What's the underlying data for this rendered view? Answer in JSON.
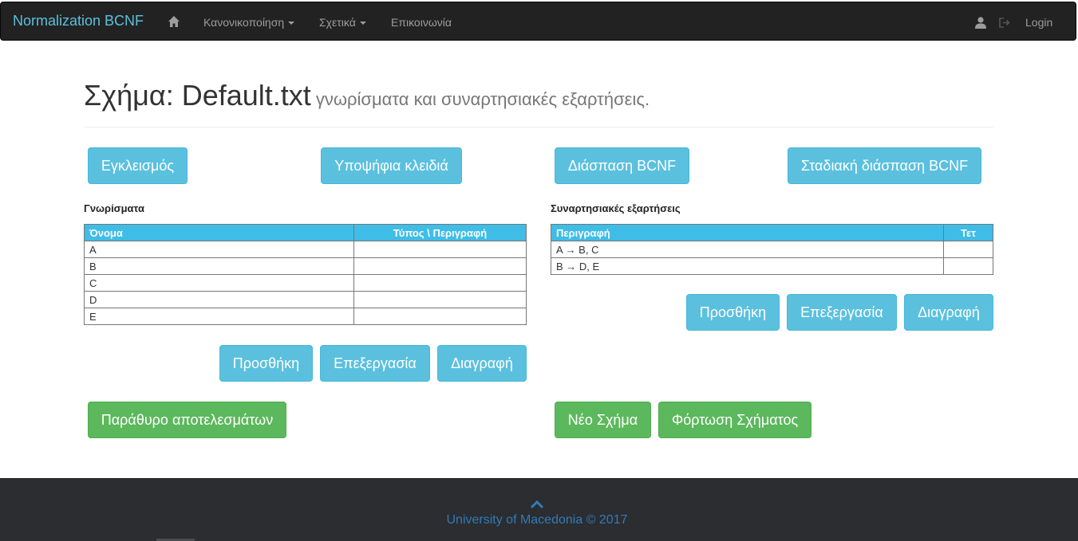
{
  "navbar": {
    "brand": "Normalization BCNF",
    "home_icon": "home-icon",
    "menu": [
      {
        "label": "Κανονικοποίηση",
        "dropdown": true
      },
      {
        "label": "Σχετικά",
        "dropdown": true
      },
      {
        "label": "Επικοινωνία",
        "dropdown": false
      }
    ],
    "user_icon": "user-icon",
    "logout_icon": "log-out-icon",
    "login_label": "Login"
  },
  "header": {
    "title": "Σχήμα: Default.txt",
    "subtitle": "γνωρίσματα και συναρτησιακές εξαρτήσεις."
  },
  "actions": {
    "closure": "Εγκλεισμός",
    "candidate_keys": "Υποψήφια κλειδιά",
    "bcnf_decomposition": "Διάσπαση BCNF",
    "stepwise_bcnf": "Σταδιακή διάσπαση BCNF"
  },
  "attributes": {
    "label": "Γνωρίσματα",
    "columns": [
      "Όνομα",
      "Τύπος \\ Περιγραφή"
    ],
    "rows": [
      {
        "name": "A",
        "type": ""
      },
      {
        "name": "B",
        "type": ""
      },
      {
        "name": "C",
        "type": ""
      },
      {
        "name": "D",
        "type": ""
      },
      {
        "name": "E",
        "type": ""
      }
    ],
    "add": "Προσθήκη",
    "edit": "Επεξεργασία",
    "delete": "Διαγραφή"
  },
  "dependencies": {
    "label": "Συναρτησιακές εξαρτήσεις",
    "columns": [
      "Περιγραφή",
      "Τετ"
    ],
    "rows": [
      {
        "desc": "A → B, C",
        "tet": ""
      },
      {
        "desc": "B → D, E",
        "tet": ""
      }
    ],
    "add": "Προσθήκη",
    "edit": "Επεξεργασία",
    "delete": "Διαγραφή"
  },
  "bottom": {
    "results_window": "Παράθυρο αποτελεσμάτων",
    "new_schema": "Νέο Σχήμα",
    "load_schema": "Φόρτωση Σχήματος"
  },
  "footer": {
    "up_icon": "chevron-up-icon",
    "text": "University of Macedonia © 2017"
  },
  "colors": {
    "navbar_bg": "#222222",
    "brand": "#5bc0de",
    "btn_info": "#5bc0de",
    "btn_success": "#5cb85c",
    "table_header": "#3fbde6",
    "footer_bg": "#2b2d30",
    "footer_link": "#337ab7"
  }
}
